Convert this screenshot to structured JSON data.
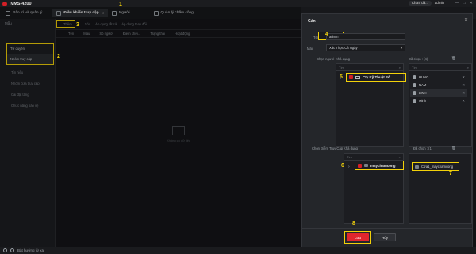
{
  "app": {
    "title": "iVMS-4200",
    "online_label": "Chưa đă...",
    "user": "admin",
    "win_controls": [
      "—",
      "□",
      "✕"
    ]
  },
  "tabs": [
    {
      "label": "Bảo trì và quản lý"
    },
    {
      "label": "Điều khiển truy cập",
      "active": true
    },
    {
      "label": "Người"
    },
    {
      "label": "Quản lý chấm công"
    }
  ],
  "sidebar": {
    "header": "Mẫu",
    "group_label": "Tư quyền",
    "selected_item": "Nhóm truy cập",
    "items": [
      "Tín hiệu",
      "Nhóm cửa truy cập",
      "Cài đặt tầng",
      "Chức năng bảo vệ"
    ]
  },
  "main": {
    "toolbar": [
      "Thêm",
      "Xóa",
      "Áp dụng tất cả",
      "Áp dụng thay đổi"
    ],
    "columns": [
      "Tên",
      "Mẫu",
      "Số người",
      "Điểm khởi...",
      "Trạng thái",
      "Hoạt động"
    ],
    "empty_text": "Không có dữ liệu"
  },
  "dialog": {
    "title": "Gán",
    "name_label": "Tên",
    "name_value": "admin",
    "template_label": "Mẫu",
    "template_value": "Xác Thực Cả Ngày",
    "choose_person_label": "Chọn người",
    "available_label": "Khả dụng",
    "selected_count_label": "Đã chọn : (4)",
    "search_placeholder": "Tìm",
    "org_item": "Cty Kỹ Thuật Số",
    "persons": [
      "HUNG",
      "NAM",
      "LINH",
      "Minh"
    ],
    "choose_point_label": "Chọn Điểm Truy Cập",
    "point_available_label": "Khả dụng",
    "point_selected_label": "Đã chọn : (1)",
    "device_item": "maychamcong",
    "selected_door": "Cửa1_maychamcong",
    "save_label": "Lưu",
    "cancel_label": "Hủy"
  },
  "annotations": [
    "1",
    "2",
    "3",
    "4",
    "5",
    "6",
    "7",
    "8"
  ],
  "statusbar": {
    "text": "Bật hướng từ xa"
  },
  "colors": {
    "accent": "#e0262d",
    "highlight": "#f2d10a",
    "background": "#111214"
  }
}
